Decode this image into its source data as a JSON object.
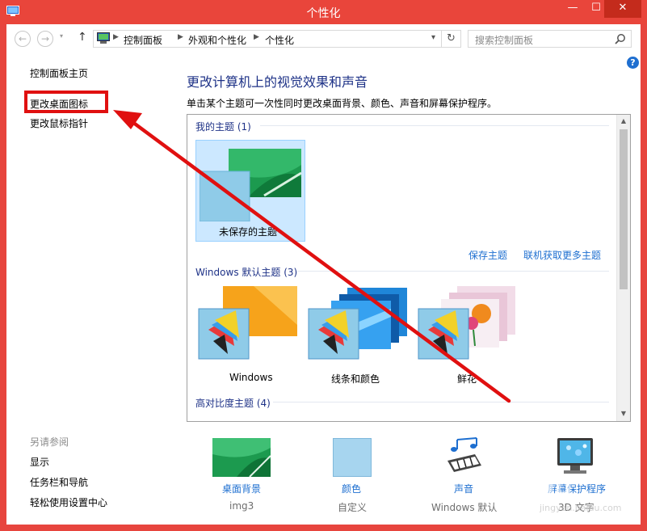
{
  "window": {
    "title": "个性化",
    "minimize": "—",
    "maximize": "☐",
    "close": "✕"
  },
  "nav": {
    "back": "←",
    "forward": "→",
    "dropdown": "▾",
    "up": "↑",
    "breadcrumb": [
      "控制面板",
      "外观和个性化",
      "个性化"
    ],
    "refresh": "↻",
    "search_placeholder": "搜索控制面板"
  },
  "help": "?",
  "sidebar": {
    "links": [
      "控制面板主页",
      "更改桌面图标",
      "更改鼠标指针"
    ],
    "see_also_title": "另请参阅",
    "see_also": [
      "显示",
      "任务栏和导航",
      "轻松使用设置中心"
    ]
  },
  "main": {
    "title": "更改计算机上的视觉效果和声音",
    "description": "单击某个主题可一次性同时更改桌面背景、颜色、声音和屏幕保护程序。",
    "groups": [
      {
        "header": "我的主题 (1)",
        "themes": [
          "未保存的主题"
        ]
      },
      {
        "header": "Windows 默认主题 (3)",
        "themes": [
          "Windows",
          "线条和颜色",
          "鲜花"
        ]
      },
      {
        "header": "高对比度主题 (4)",
        "themes": []
      }
    ],
    "actions": [
      "保存主题",
      "联机获取更多主题"
    ]
  },
  "bottom": [
    {
      "label": "桌面背景",
      "sub": "img3",
      "icon": "wallpaper-icon"
    },
    {
      "label": "颜色",
      "sub": "自定义",
      "icon": "color-icon"
    },
    {
      "label": "声音",
      "sub": "Windows 默认",
      "icon": "sound-icon"
    },
    {
      "label": "屏幕保护程序",
      "sub": "3D 文字",
      "icon": "screensaver-icon"
    }
  ],
  "colors": {
    "titlebar": "#e9453b",
    "link": "#1e6fd0",
    "heading": "#1e3287",
    "annotation_red": "#e01010",
    "selected_tile": "#cce8ff"
  },
  "watermark": {
    "brand": "Baidu",
    "sub": "jingyan.baidu.com"
  }
}
